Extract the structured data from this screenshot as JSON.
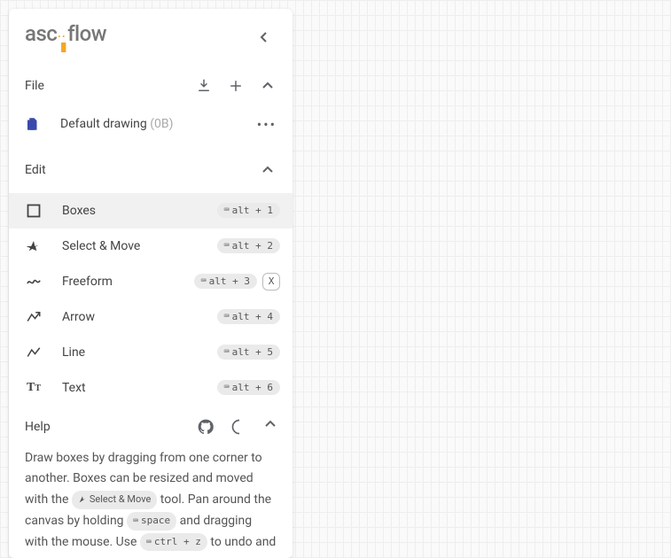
{
  "logo": {
    "pre": "asc",
    "post": "flow"
  },
  "sections": {
    "file": "File",
    "edit": "Edit",
    "help": "Help"
  },
  "file_entry": {
    "name": "Default drawing",
    "size": "(0B)"
  },
  "tools": {
    "boxes": {
      "label": "Boxes",
      "shortcut": "alt + 1"
    },
    "select": {
      "label": "Select & Move",
      "shortcut": "alt + 2"
    },
    "freeform": {
      "label": "Freeform",
      "shortcut": "alt + 3",
      "char": "X"
    },
    "arrow": {
      "label": "Arrow",
      "shortcut": "alt + 4"
    },
    "line": {
      "label": "Line",
      "shortcut": "alt + 5"
    },
    "text": {
      "label": "Text",
      "shortcut": "alt + 6"
    }
  },
  "help_text": {
    "p1": "Draw boxes by dragging from one corner to another. Boxes can be resized and moved with the ",
    "chip1": "Select & Move",
    "p2": " tool. Pan around the canvas by holding ",
    "chip2": "space",
    "p3": " and dragging with the mouse. Use ",
    "chip3": "ctrl + z",
    "p4": " to undo and"
  }
}
